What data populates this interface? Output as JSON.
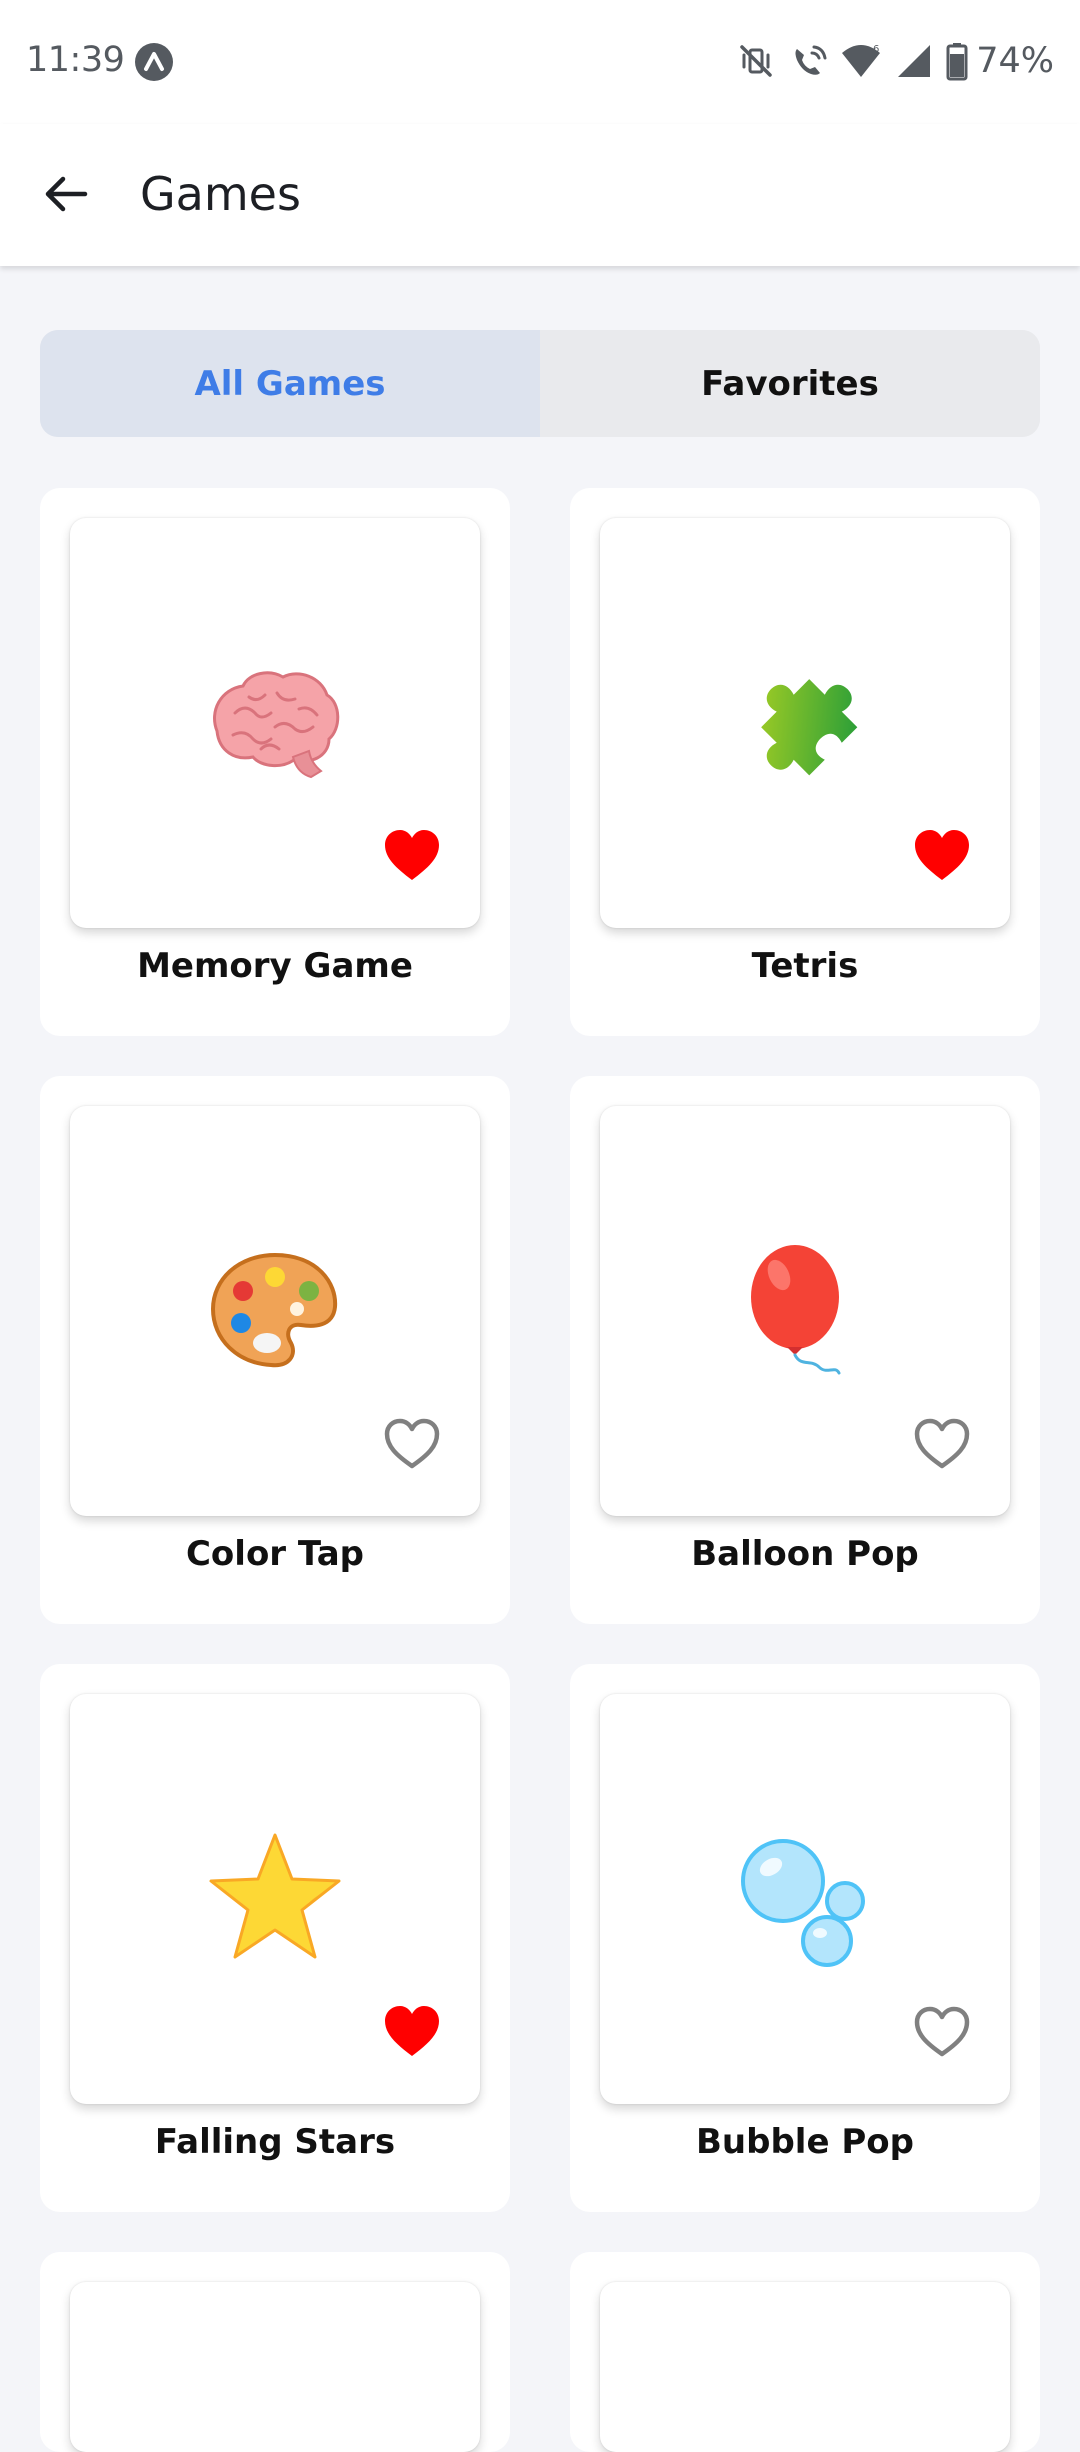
{
  "status_bar": {
    "time": "11:39",
    "battery_percent": "74%",
    "icons": [
      "app-notification-icon",
      "mute-vibrate-icon",
      "wifi-call-icon",
      "wifi-icon",
      "signal-icon",
      "battery-icon"
    ]
  },
  "app_bar": {
    "title": "Games",
    "back_icon": "arrow-left-icon"
  },
  "tabs": [
    {
      "label": "All Games",
      "selected": true
    },
    {
      "label": "Favorites",
      "selected": false
    }
  ],
  "games": [
    {
      "name": "Memory Game",
      "icon": "brain-icon",
      "favorite": true
    },
    {
      "name": "Tetris",
      "icon": "puzzle-piece-icon",
      "favorite": true
    },
    {
      "name": "Color Tap",
      "icon": "artist-palette-icon",
      "favorite": false
    },
    {
      "name": "Balloon Pop",
      "icon": "balloon-icon",
      "favorite": false
    },
    {
      "name": "Falling Stars",
      "icon": "star-icon",
      "favorite": true
    },
    {
      "name": "Bubble Pop",
      "icon": "bubbles-icon",
      "favorite": false
    }
  ],
  "colors": {
    "accent": "#3f7de7",
    "favorite": "#ff0000",
    "not_favorite": "#808080",
    "background": "#f4f5f9"
  }
}
